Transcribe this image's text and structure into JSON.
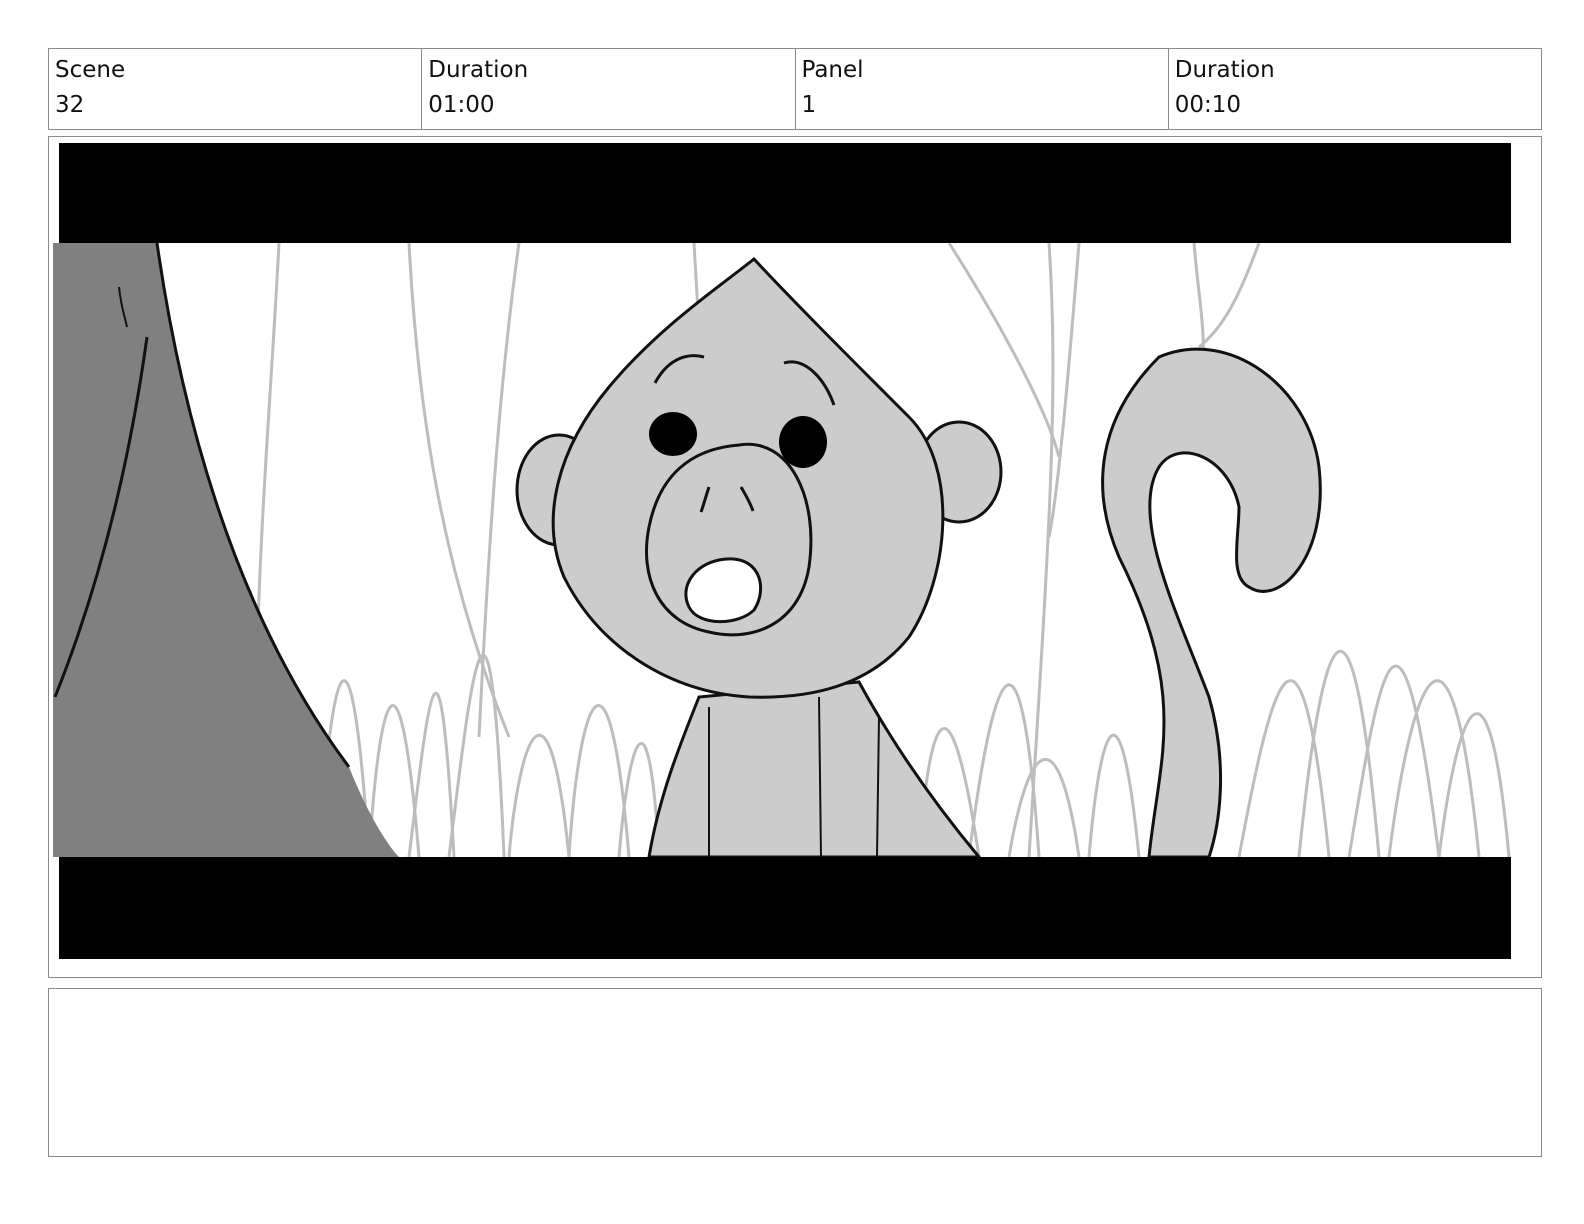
{
  "header": {
    "scene": {
      "label": "Scene",
      "value": "32"
    },
    "scene_duration": {
      "label": "Duration",
      "value": "01:00"
    },
    "panel": {
      "label": "Panel",
      "value": "1"
    },
    "panel_duration": {
      "label": "Duration",
      "value": "00:10"
    }
  },
  "notes": {
    "text": ""
  },
  "colors": {
    "letterbox": "#000000",
    "tree": "#808080",
    "character": "#cccccc",
    "grass": "#bdbdbd"
  }
}
